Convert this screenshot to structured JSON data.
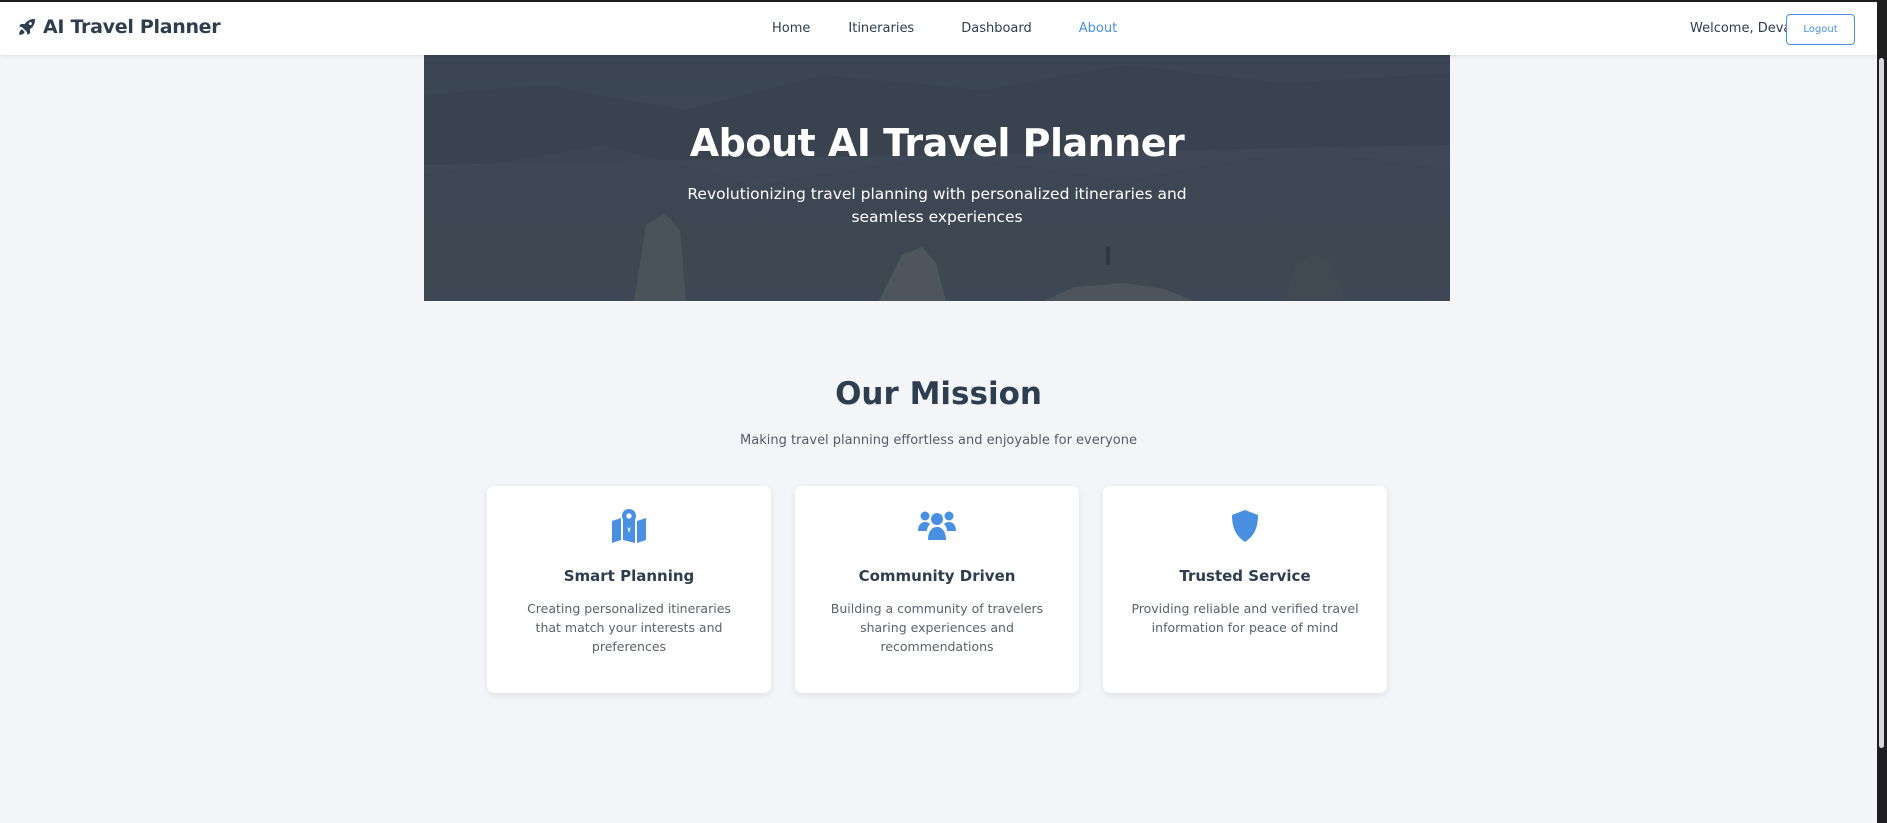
{
  "brand": {
    "name": "AI Travel Planner",
    "icon": "rocket-icon"
  },
  "nav": {
    "links": [
      {
        "label": "Home",
        "active": false
      },
      {
        "label": "Itineraries",
        "active": false
      },
      {
        "label": "Dashboard",
        "active": false
      },
      {
        "label": "About",
        "active": true
      }
    ],
    "welcome": "Welcome, Deva",
    "logout_label": "Logout"
  },
  "hero": {
    "title": "About AI Travel Planner",
    "subtitle": "Revolutionizing travel planning with personalized itineraries and seamless experiences"
  },
  "mission": {
    "title": "Our Mission",
    "subtitle": "Making travel planning effortless and enjoyable for everyone",
    "cards": [
      {
        "icon": "map-icon",
        "title": "Smart Planning",
        "description": "Creating personalized itineraries that match your interests and preferences"
      },
      {
        "icon": "users-icon",
        "title": "Community Driven",
        "description": "Building a community of travelers sharing experiences and recommendations"
      },
      {
        "icon": "shield-icon",
        "title": "Trusted Service",
        "description": "Providing reliable and verified travel information for peace of mind"
      }
    ]
  },
  "colors": {
    "accent": "#4a90e2",
    "text_dark": "#2c3e50",
    "background": "#f3f5f9"
  }
}
